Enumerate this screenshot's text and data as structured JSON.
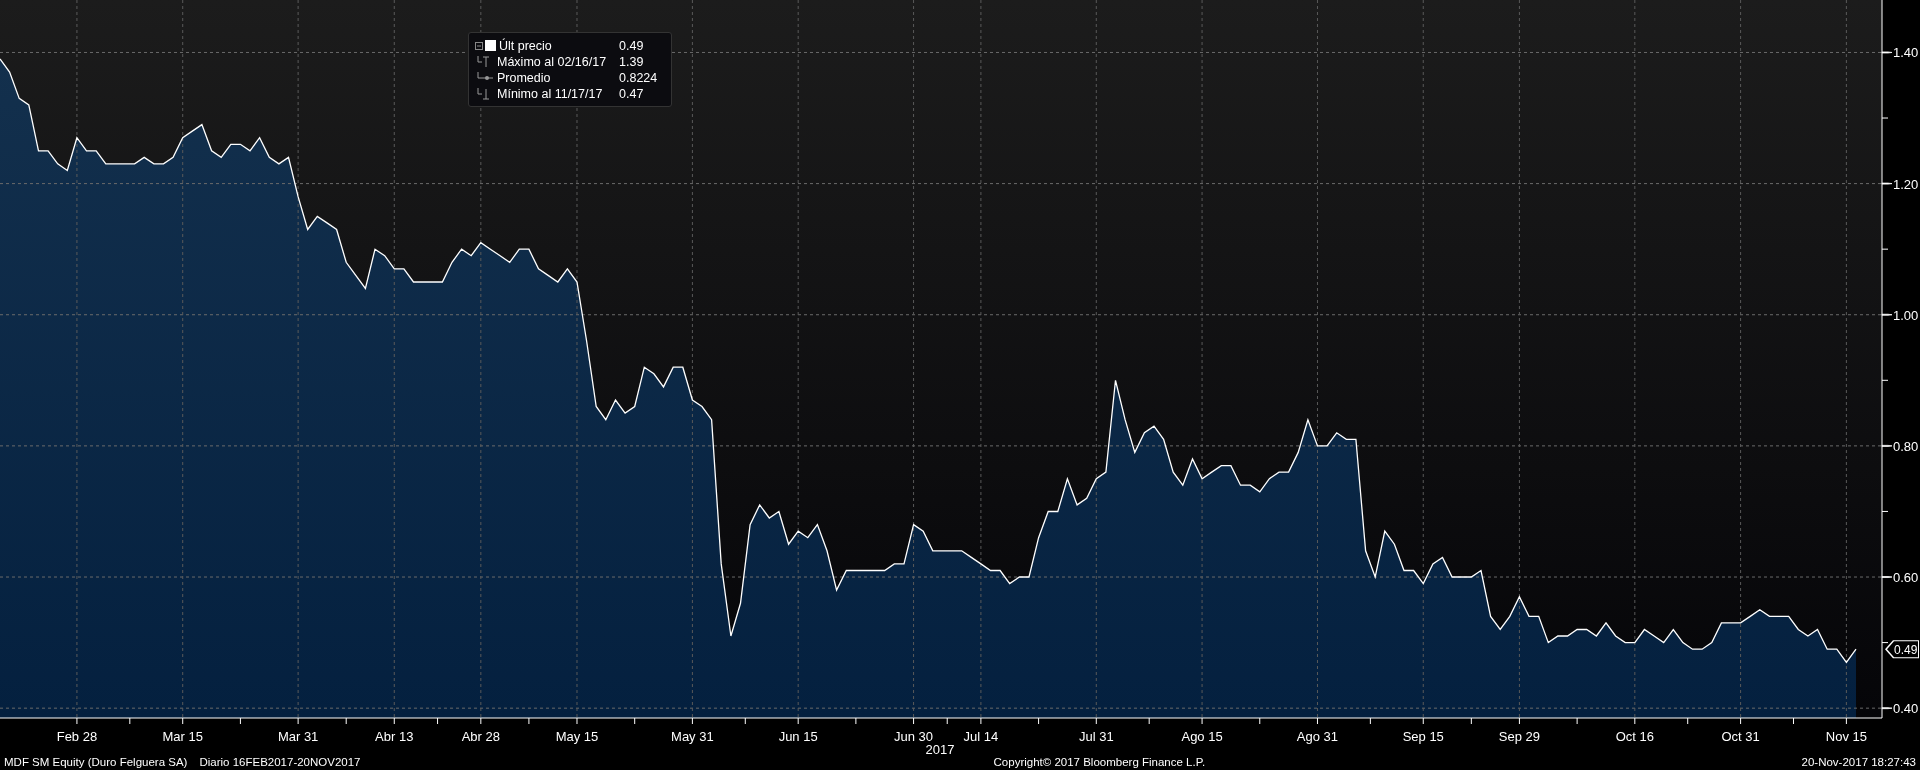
{
  "chart": {
    "legend": [
      {
        "kind": "last",
        "value": "0.49"
      },
      {
        "kind": "max",
        "label": "Máximo al 02/16/17",
        "value": "1.39"
      },
      {
        "kind": "avg",
        "label": "Promedio",
        "value": "0.8224"
      },
      {
        "kind": "min",
        "label": "Mínimo al 11/17/17",
        "value": "0.47"
      }
    ],
    "chart_data": {
      "type": "area",
      "xlabel": "2017",
      "grid": true,
      "ylim": [
        0.385,
        1.48
      ],
      "categories": [
        null,
        null,
        null,
        null,
        null,
        null,
        null,
        null,
        "Feb 28",
        null,
        null,
        null,
        null,
        null,
        null,
        null,
        null,
        null,
        null,
        "Mar 15",
        null,
        null,
        null,
        null,
        null,
        null,
        null,
        null,
        null,
        null,
        null,
        "Mar 31",
        null,
        null,
        null,
        null,
        null,
        null,
        null,
        null,
        null,
        "Abr 13",
        null,
        null,
        null,
        null,
        null,
        null,
        null,
        null,
        "Abr 28",
        null,
        null,
        null,
        null,
        null,
        null,
        null,
        null,
        null,
        "May 15",
        null,
        null,
        null,
        null,
        null,
        null,
        null,
        null,
        null,
        null,
        null,
        "May 31",
        null,
        null,
        null,
        null,
        null,
        null,
        null,
        null,
        null,
        null,
        "Jun 15",
        null,
        null,
        null,
        null,
        null,
        null,
        null,
        null,
        null,
        null,
        null,
        "Jun 30",
        null,
        null,
        null,
        null,
        null,
        null,
        "Jul 14",
        null,
        null,
        null,
        null,
        null,
        null,
        null,
        null,
        null,
        null,
        null,
        "Jul 31",
        null,
        null,
        null,
        null,
        null,
        null,
        null,
        null,
        null,
        null,
        "Ago 15",
        null,
        null,
        null,
        null,
        null,
        null,
        null,
        null,
        null,
        null,
        null,
        "Ago 31",
        null,
        null,
        null,
        null,
        null,
        null,
        null,
        null,
        null,
        null,
        "Sep 15",
        null,
        null,
        null,
        null,
        null,
        null,
        null,
        null,
        null,
        "Sep 29",
        null,
        null,
        null,
        null,
        null,
        null,
        null,
        null,
        null,
        null,
        null,
        "Oct 16",
        null,
        null,
        null,
        null,
        null,
        null,
        null,
        null,
        null,
        null,
        "Oct 31",
        null,
        null,
        null,
        null,
        null,
        null,
        null,
        null,
        null,
        null,
        "Nov 15",
        null
      ],
      "series": [
        {
          "name": "Últ precio",
          "color": "#ffffff",
          "values": [
            1.39,
            1.37,
            1.33,
            1.32,
            1.25,
            1.25,
            1.23,
            1.22,
            1.27,
            1.25,
            1.25,
            1.23,
            1.23,
            1.23,
            1.23,
            1.24,
            1.23,
            1.23,
            1.24,
            1.27,
            1.28,
            1.29,
            1.25,
            1.24,
            1.26,
            1.26,
            1.25,
            1.27,
            1.24,
            1.23,
            1.24,
            1.18,
            1.13,
            1.15,
            1.14,
            1.13,
            1.08,
            1.06,
            1.04,
            1.1,
            1.09,
            1.07,
            1.07,
            1.05,
            1.05,
            1.05,
            1.05,
            1.08,
            1.1,
            1.09,
            1.11,
            1.1,
            1.09,
            1.08,
            1.1,
            1.1,
            1.07,
            1.06,
            1.05,
            1.07,
            1.05,
            0.96,
            0.86,
            0.84,
            0.87,
            0.85,
            0.86,
            0.92,
            0.91,
            0.89,
            0.92,
            0.92,
            0.87,
            0.86,
            0.84,
            0.62,
            0.51,
            0.56,
            0.68,
            0.71,
            0.69,
            0.7,
            0.65,
            0.67,
            0.66,
            0.68,
            0.64,
            0.58,
            0.61,
            0.61,
            0.61,
            0.61,
            0.61,
            0.62,
            0.62,
            0.68,
            0.67,
            0.64,
            0.64,
            0.64,
            0.64,
            0.63,
            0.62,
            0.61,
            0.61,
            0.59,
            0.6,
            0.6,
            0.66,
            0.7,
            0.7,
            0.75,
            0.71,
            0.72,
            0.75,
            0.76,
            0.9,
            0.84,
            0.79,
            0.82,
            0.83,
            0.81,
            0.76,
            0.74,
            0.78,
            0.75,
            0.76,
            0.77,
            0.77,
            0.74,
            0.74,
            0.73,
            0.75,
            0.76,
            0.76,
            0.79,
            0.84,
            0.8,
            0.8,
            0.82,
            0.81,
            0.81,
            0.64,
            0.6,
            0.67,
            0.65,
            0.61,
            0.61,
            0.59,
            0.62,
            0.63,
            0.6,
            0.6,
            0.6,
            0.61,
            0.54,
            0.52,
            0.54,
            0.57,
            0.54,
            0.54,
            0.5,
            0.51,
            0.51,
            0.52,
            0.52,
            0.51,
            0.53,
            0.51,
            0.5,
            0.5,
            0.52,
            0.51,
            0.5,
            0.52,
            0.5,
            0.49,
            0.49,
            0.5,
            0.53,
            0.53,
            0.53,
            0.54,
            0.55,
            0.54,
            0.54,
            0.54,
            0.52,
            0.51,
            0.52,
            0.49,
            0.49,
            0.47,
            0.49
          ]
        }
      ],
      "yticks": [
        {
          "value": 0.4,
          "label": "0.40"
        },
        {
          "value": 0.6,
          "label": "0.60"
        },
        {
          "value": 0.8,
          "label": "0.80"
        },
        {
          "value": 1.0,
          "label": "1.00"
        },
        {
          "value": 1.2,
          "label": "1.20"
        },
        {
          "value": 1.4,
          "label": "1.40"
        }
      ],
      "annotations": [
        "0.49"
      ]
    }
  },
  "footer": {
    "security": "MDF SM Equity (Duro Felguera SA)",
    "period": "Diario 16FEB2017-20NOV2017",
    "copyright": "Copyright© 2017 Bloomberg Finance L.P.",
    "timestamp": "20-Nov-2017 18:27:43"
  }
}
